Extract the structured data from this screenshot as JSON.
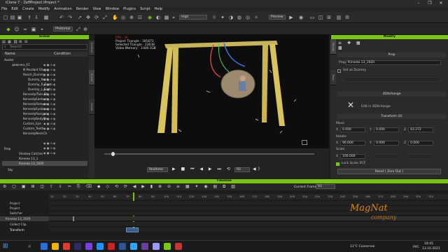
{
  "window": {
    "title": "iClone 7 - ZeffProject.iProject *",
    "controls": [
      "–",
      "❐",
      "✕"
    ]
  },
  "menu": [
    "File",
    "Edit",
    "Create",
    "Modify",
    "Animation",
    "Render",
    "View",
    "Window",
    "Plugins",
    "Script",
    "Help"
  ],
  "toolbar": {
    "quality": "High",
    "preview": "Preview",
    "camera": "Photoreal"
  },
  "scene_panel": {
    "title": "Scene",
    "search_placeholder": "Search",
    "columns": [
      "Name",
      "Condition"
    ],
    "items": [
      {
        "label": "Avatar"
      },
      {
        "label": "девочка_01"
      },
      {
        "label": "N Pendant Shape"
      },
      {
        "label": "Reach_Dummy"
      },
      {
        "label": "Dummy_Neck"
      },
      {
        "label": "Dummy_R_Foot"
      },
      {
        "label": "Dummy_L_Foot"
      },
      {
        "label": "Kennedy/Tails.Dh"
      },
      {
        "label": "KennedyEastsum"
      },
      {
        "label": "KennedyRompar"
      },
      {
        "label": "KennedyEyebrow"
      },
      {
        "label": "KennedyRompar"
      },
      {
        "label": "KennedyBodySh"
      },
      {
        "label": "Custom_Eye"
      },
      {
        "label": "Custom_Teeth"
      },
      {
        "label": "KennedyNeckCh"
      },
      {
        "label": "Prop"
      },
      {
        "label": "Shadow Catcher"
      },
      {
        "label": "Качели 13_1"
      },
      {
        "label": "Качели 13_1920"
      },
      {
        "label": "Sky"
      }
    ],
    "side_tabs": [
      "Content",
      "Scene",
      "Visual"
    ]
  },
  "viewport": {
    "stats": [
      "FPS : 30",
      "Project Triangle : 181871",
      "Selected Triangle : 23038",
      "Video Memory : 3.8/8.1GB"
    ],
    "playbar": {
      "mode": "Realtime",
      "frame": "93"
    }
  },
  "modify_panel": {
    "title": "Modify",
    "side_tabs": [
      "Modify",
      "Tools"
    ],
    "prop_section": "Prop",
    "prop_label": "Prop",
    "prop_value": "Качели 13_1920",
    "set_as_dummy": "Set as Dummy",
    "exchange_section": "3DXchange",
    "exchange_button": "Edit in 3DXchange",
    "transform_section": "Transform (0)",
    "move_label": "Move",
    "move": {
      "x": "0.000",
      "y": "0.000",
      "z": "43.272"
    },
    "rotate_label": "Rotate",
    "rotate": {
      "x": "90.000",
      "y": "0.000",
      "z": "0.000"
    },
    "scale_label": "Scale",
    "scale": {
      "x": "100.000"
    },
    "lock_scale": "Lock Scale XYZ",
    "reset_button": "Reset ( Zero Out )"
  },
  "timeline": {
    "title": "Timeline",
    "current_frame_label": "Current Frame:",
    "current_frame": "93",
    "ruler_ticks": [
      "10",
      "20",
      "30",
      "40",
      "50",
      "60",
      "70",
      "80",
      "90",
      "100",
      "110",
      "120",
      "130",
      "140",
      "150",
      "160",
      "170",
      "180",
      "190",
      "200",
      "210",
      "220",
      "230",
      "240",
      "250",
      "260",
      "270",
      "280",
      "290",
      "300",
      "310"
    ],
    "tracks": [
      {
        "label": "Project"
      },
      {
        "label": "Project"
      },
      {
        "label": "Switcher"
      },
      {
        "label": "Качели 13_1920"
      },
      {
        "label": "Collect Clip"
      },
      {
        "label": "Transform"
      }
    ]
  },
  "watermark": {
    "line1": "MagNat",
    "line2": "company"
  },
  "taskbar": {
    "weather": "11°C Солнечно",
    "lang": "РУС",
    "time": "18:45",
    "date": "13.10.2021"
  },
  "colors": {
    "accent": "#7cc412",
    "panel": "#2a2a2a",
    "viewport": "#0d0d0d"
  }
}
